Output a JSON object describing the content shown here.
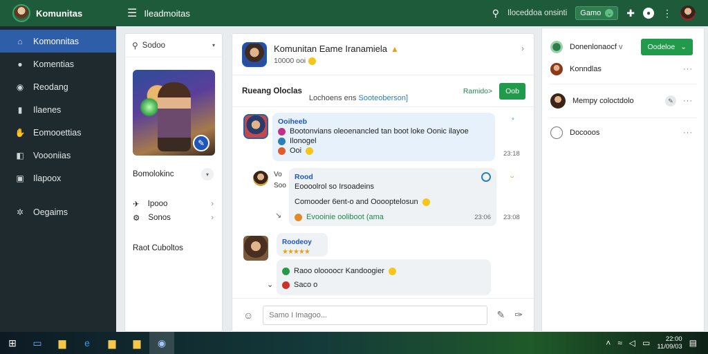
{
  "app": {
    "brand": "Komunitas",
    "top_title": "Ileadmoitas"
  },
  "sidebar": {
    "items": [
      {
        "icon": "house-icon",
        "label": "Komonnitas"
      },
      {
        "icon": "user-icon",
        "label": "Komentias"
      },
      {
        "icon": "person-icon",
        "label": "Reodang"
      },
      {
        "icon": "list-icon",
        "label": "Ilaenes"
      },
      {
        "icon": "hand-icon",
        "label": "Eomooettias"
      },
      {
        "icon": "shield-icon",
        "label": "Voooniias"
      },
      {
        "icon": "document-icon",
        "label": "Ilapoox"
      }
    ],
    "settings_label": "Oegaims"
  },
  "topbar": {
    "search_text": "Iloceddoa onsinti",
    "game_btn": "Gamo",
    "dot_label": "●"
  },
  "left_panel": {
    "search_text": "Sodoo",
    "profile_name": "Bomolokinc",
    "items": [
      {
        "icon": "pin-icon",
        "label": "Ipooo"
      },
      {
        "icon": "settings-icon",
        "label": "Sonos"
      }
    ],
    "section_label": "Raot Cuboltos"
  },
  "chat": {
    "title": "Komunitan Eame Iranamiela",
    "subtitle": "10000 ooi",
    "bar_title": "Rueang Oloclas",
    "bar_sub_prefix": "Lochoens ens",
    "bar_sub_link": "Sooteoberson]",
    "bar_link": "Ramido>",
    "bar_button": "Oob",
    "messages": [
      {
        "head": "Ooiheeb",
        "line1": "Bootonvians oleoenancled tan boot loke Oonic ilayoe",
        "line2": "Ilonogel",
        "line3": "Ooi",
        "time": "23:18",
        "mark": "°"
      },
      {
        "head": "Rood",
        "side1": "Vo",
        "side2": "Soo",
        "line1": "Eoooolrol so Irsoadeins",
        "line2": "Comooder 6ent-o and Ooooptelosun",
        "line3": "Evooinie ooliboot (ama",
        "time_in": "23:06",
        "time_out": "23:08",
        "mark": "ᴗ"
      },
      {
        "head": "Roodeoy",
        "line1": "Raoo oloooocr Kandoogier",
        "line2": "Saco o",
        "stars": "★★★★★"
      }
    ],
    "composer_placeholder": "Samo I Imagoo..."
  },
  "right_panel": {
    "rows": [
      {
        "label": "Donenlonaocf",
        "suffix": "v"
      },
      {
        "label": "Konndlas"
      },
      {
        "label": "Mempy coloctdolo"
      },
      {
        "label": "Docooos"
      }
    ],
    "button": "Oodeloe",
    "dots": "···"
  },
  "taskbar": {
    "time": "22:00",
    "date": "11/09/03"
  },
  "colors": {
    "sidebar_bg": "#1f2a2e",
    "accent_green": "#1d5b3a",
    "button_green": "#229a4c",
    "active_blue": "#2f5ea8"
  }
}
